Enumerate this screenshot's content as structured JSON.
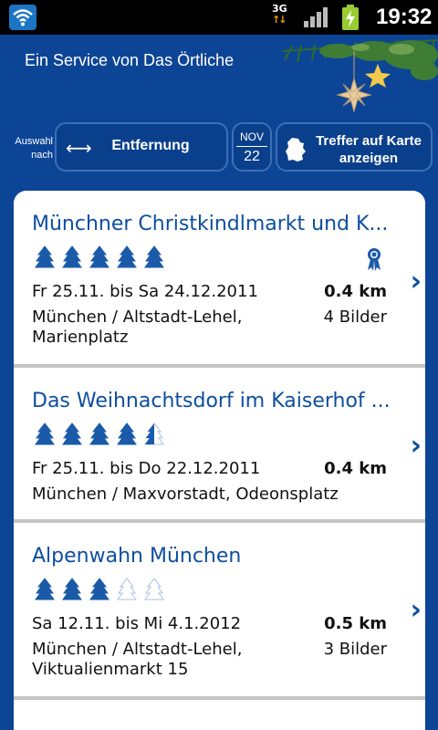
{
  "statusbar": {
    "network": "3G",
    "time": "19:32"
  },
  "header": {
    "tagline": "Ein Service von Das Örtliche"
  },
  "toolbar": {
    "sort_label": "Auswahl nach",
    "sort_value": "Entfernung",
    "date_month": "NOV",
    "date_day": "22",
    "map_button": "Treffer auf Karte anzeigen"
  },
  "colors": {
    "brand_blue": "#0d4596",
    "title_blue": "#0d4e9e",
    "tree_blue": "#1a5aa8"
  },
  "icons": {
    "sort": "left-right-arrow-icon",
    "map": "germany-map-icon",
    "chevron": "chevron-right-icon",
    "award": "award-ribbon-icon",
    "rating": "tree-icon"
  },
  "items": [
    {
      "title": "Münchner Christkindlmarkt und K...",
      "rating": 5,
      "award": true,
      "dates": "Fr 25.11. bis Sa 24.12.2011",
      "distance": "0.4 km",
      "location": "München / Altstadt-Lehel, Marienplatz",
      "pictures": "4 Bilder"
    },
    {
      "title": "Das Weihnachtsdorf im Kaiserhof ...",
      "rating": 4.5,
      "award": false,
      "dates": "Fr 25.11. bis Do 22.12.2011",
      "distance": "0.4 km",
      "location": "München / Maxvorstadt, Odeonsplatz",
      "pictures": ""
    },
    {
      "title": "Alpenwahn München",
      "rating": 3,
      "award": false,
      "dates": "Sa 12.11. bis Mi 4.1.2012",
      "distance": "0.5 km",
      "location": "München / Altstadt-Lehel, Viktualienmarkt 15",
      "pictures": "3 Bilder"
    }
  ]
}
